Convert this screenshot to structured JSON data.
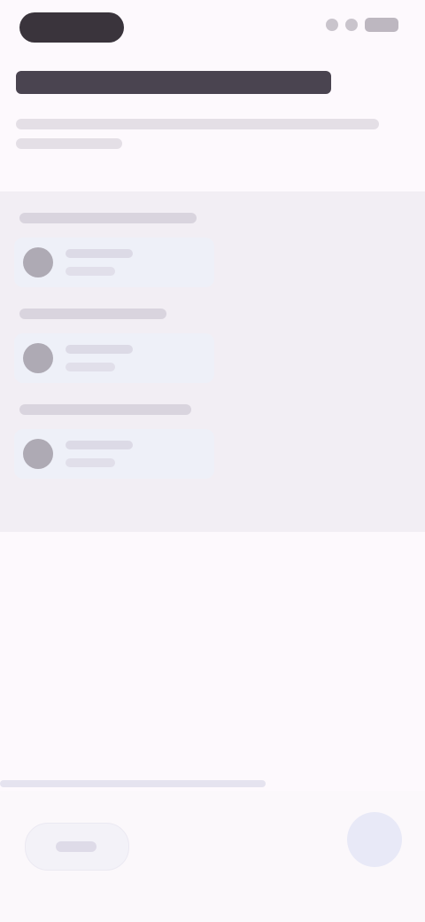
{
  "status_bar": {
    "time": "",
    "icons": [
      "signal-icon",
      "wifi-icon",
      "battery-icon"
    ]
  },
  "header": {
    "title": "",
    "subtitle": ""
  },
  "list": {
    "groups": [
      {
        "header": "",
        "item": {
          "title": "",
          "subtitle": ""
        }
      },
      {
        "header": "",
        "item": {
          "title": "",
          "subtitle": ""
        }
      },
      {
        "header": "",
        "item": {
          "title": "",
          "subtitle": ""
        }
      }
    ]
  },
  "footer": {
    "back_label": "",
    "next_icon": "arrow-forward-icon"
  },
  "colors": {
    "background": "#fdf9fd",
    "panel": "#f2eef4",
    "row": "#eef0f8",
    "title": "#4a4450"
  }
}
